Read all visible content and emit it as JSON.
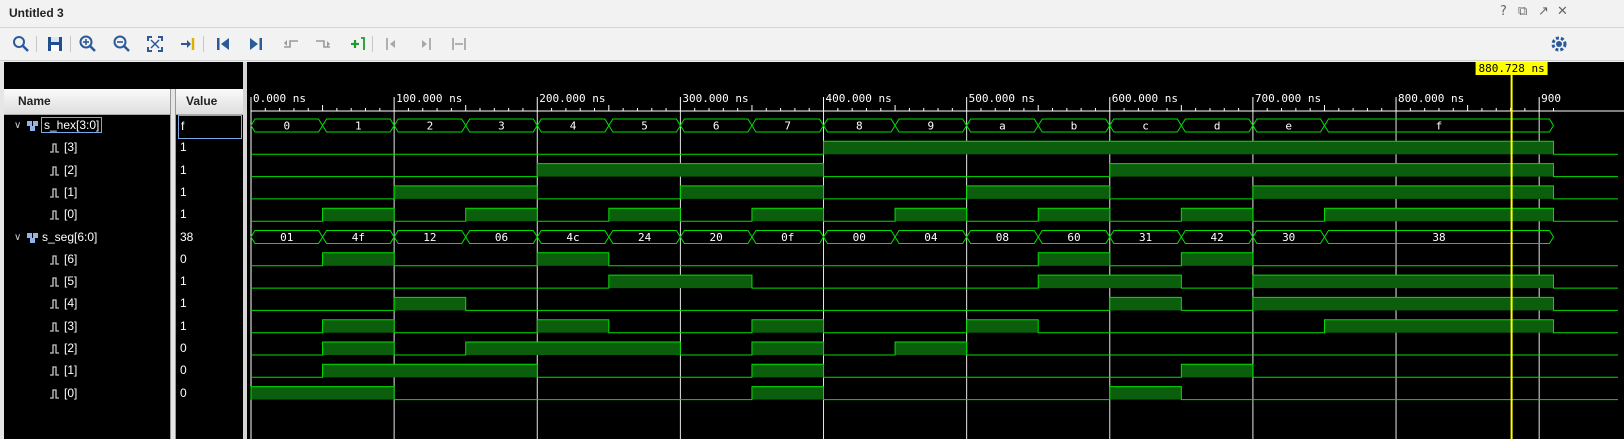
{
  "window": {
    "title": "Untitled 3",
    "controls": [
      "help-icon",
      "restore-icon",
      "popout-icon",
      "close-icon"
    ],
    "control_glyphs": [
      "?",
      "⧉",
      "↗",
      "✕"
    ]
  },
  "toolbar": {
    "buttons": [
      "search-icon",
      "save-icon",
      "zoom-in-icon",
      "zoom-out-icon",
      "zoom-fit-icon",
      "goto-cursor-icon",
      "go-to-start-icon",
      "go-to-end-icon",
      "previous-transition-icon",
      "next-transition-icon",
      "add-marker-icon",
      "previous-marker-icon",
      "next-marker-icon",
      "swap-cursors-icon",
      "settings-icon"
    ]
  },
  "columns": {
    "name": "Name",
    "value": "Value"
  },
  "signals": [
    {
      "name": "s_hex[3:0]",
      "value": "f",
      "kind": "bus",
      "selected": true
    },
    {
      "name": "[3]",
      "value": "1",
      "kind": "bit"
    },
    {
      "name": "[2]",
      "value": "1",
      "kind": "bit"
    },
    {
      "name": "[1]",
      "value": "1",
      "kind": "bit"
    },
    {
      "name": "[0]",
      "value": "1",
      "kind": "bit"
    },
    {
      "name": "s_seg[6:0]",
      "value": "38",
      "kind": "bus"
    },
    {
      "name": "[6]",
      "value": "0",
      "kind": "bit"
    },
    {
      "name": "[5]",
      "value": "1",
      "kind": "bit"
    },
    {
      "name": "[4]",
      "value": "1",
      "kind": "bit"
    },
    {
      "name": "[3]",
      "value": "1",
      "kind": "bit"
    },
    {
      "name": "[2]",
      "value": "0",
      "kind": "bit"
    },
    {
      "name": "[1]",
      "value": "0",
      "kind": "bit"
    },
    {
      "name": "[0]",
      "value": "0",
      "kind": "bit"
    }
  ],
  "waveform": {
    "time_unit": "ns",
    "cursor": {
      "time": 880.728,
      "label": "880.728 ns"
    },
    "ruler_labels": [
      "0.000 ns",
      "100.000 ns",
      "200.000 ns",
      "300.000 ns",
      "400.000 ns",
      "500.000 ns",
      "600.000 ns",
      "700.000 ns",
      "800.000 ns",
      "900"
    ],
    "ruler_times": [
      0,
      100,
      200,
      300,
      400,
      500,
      600,
      700,
      800,
      900
    ],
    "view_end_time": 910,
    "colors": {
      "background": "#000000",
      "trace": "#00e000",
      "fill": "#0b5e0b",
      "grid": "#ffffff",
      "cursor": "#ffff00",
      "cursor_label_bg": "#ffff00"
    },
    "bus_segments": [
      [
        {
          "t0": 0,
          "t1": 50,
          "v": "0"
        },
        {
          "t0": 50,
          "t1": 100,
          "v": "1"
        },
        {
          "t0": 100,
          "t1": 150,
          "v": "2"
        },
        {
          "t0": 150,
          "t1": 200,
          "v": "3"
        },
        {
          "t0": 200,
          "t1": 250,
          "v": "4"
        },
        {
          "t0": 250,
          "t1": 300,
          "v": "5"
        },
        {
          "t0": 300,
          "t1": 350,
          "v": "6"
        },
        {
          "t0": 350,
          "t1": 400,
          "v": "7"
        },
        {
          "t0": 400,
          "t1": 450,
          "v": "8"
        },
        {
          "t0": 450,
          "t1": 500,
          "v": "9"
        },
        {
          "t0": 500,
          "t1": 550,
          "v": "a"
        },
        {
          "t0": 550,
          "t1": 600,
          "v": "b"
        },
        {
          "t0": 600,
          "t1": 650,
          "v": "c"
        },
        {
          "t0": 650,
          "t1": 700,
          "v": "d"
        },
        {
          "t0": 700,
          "t1": 750,
          "v": "e"
        },
        {
          "t0": 750,
          "t1": 910,
          "v": "f"
        }
      ],
      [
        {
          "t0": 0,
          "t1": 50,
          "v": "01"
        },
        {
          "t0": 50,
          "t1": 100,
          "v": "4f"
        },
        {
          "t0": 100,
          "t1": 150,
          "v": "12"
        },
        {
          "t0": 150,
          "t1": 200,
          "v": "06"
        },
        {
          "t0": 200,
          "t1": 250,
          "v": "4c"
        },
        {
          "t0": 250,
          "t1": 300,
          "v": "24"
        },
        {
          "t0": 300,
          "t1": 350,
          "v": "20"
        },
        {
          "t0": 350,
          "t1": 400,
          "v": "0f"
        },
        {
          "t0": 400,
          "t1": 450,
          "v": "00"
        },
        {
          "t0": 450,
          "t1": 500,
          "v": "04"
        },
        {
          "t0": 500,
          "t1": 550,
          "v": "08"
        },
        {
          "t0": 550,
          "t1": 600,
          "v": "60"
        },
        {
          "t0": 600,
          "t1": 650,
          "v": "31"
        },
        {
          "t0": 650,
          "t1": 700,
          "v": "42"
        },
        {
          "t0": 700,
          "t1": 750,
          "v": "30"
        },
        {
          "t0": 750,
          "t1": 910,
          "v": "38"
        }
      ]
    ],
    "bit_high_intervals": [
      null,
      [
        [
          400,
          910
        ]
      ],
      [
        [
          200,
          400
        ],
        [
          600,
          910
        ]
      ],
      [
        [
          100,
          200
        ],
        [
          300,
          400
        ],
        [
          500,
          600
        ],
        [
          700,
          910
        ]
      ],
      [
        [
          50,
          100
        ],
        [
          150,
          200
        ],
        [
          250,
          300
        ],
        [
          350,
          400
        ],
        [
          450,
          500
        ],
        [
          550,
          600
        ],
        [
          650,
          700
        ],
        [
          750,
          910
        ]
      ],
      null,
      [
        [
          50,
          100
        ],
        [
          200,
          250
        ],
        [
          550,
          600
        ],
        [
          650,
          700
        ]
      ],
      [
        [
          250,
          350
        ],
        [
          550,
          650
        ],
        [
          700,
          910
        ]
      ],
      [
        [
          100,
          150
        ],
        [
          600,
          650
        ],
        [
          700,
          910
        ]
      ],
      [
        [
          50,
          100
        ],
        [
          200,
          250
        ],
        [
          350,
          400
        ],
        [
          500,
          550
        ],
        [
          750,
          910
        ]
      ],
      [
        [
          50,
          100
        ],
        [
          150,
          300
        ],
        [
          350,
          400
        ],
        [
          450,
          500
        ]
      ],
      [
        [
          50,
          200
        ],
        [
          350,
          400
        ],
        [
          650,
          700
        ]
      ],
      [
        [
          0,
          100
        ],
        [
          350,
          400
        ],
        [
          600,
          650
        ]
      ]
    ]
  }
}
